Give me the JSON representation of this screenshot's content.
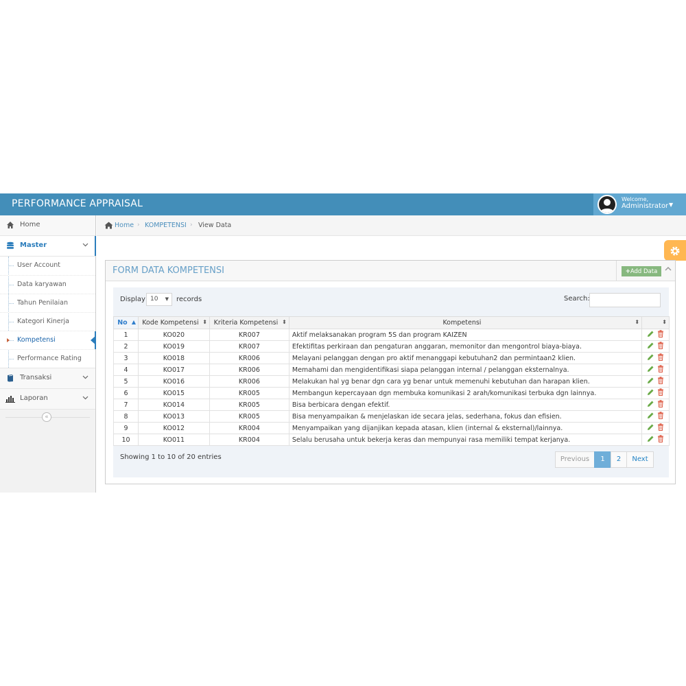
{
  "app": {
    "title": "PERFORMANCE APPRAISAL"
  },
  "user": {
    "greeting": "Welcome,",
    "name": "Administrator"
  },
  "sidebar": {
    "items": [
      {
        "label": "Home",
        "icon": "home-icon"
      },
      {
        "label": "Master",
        "icon": "database-icon"
      },
      {
        "label": "Transaksi",
        "icon": "book-icon"
      },
      {
        "label": "Laporan",
        "icon": "bar-chart-icon"
      }
    ],
    "master_sub": [
      {
        "label": "User Account"
      },
      {
        "label": "Data karyawan"
      },
      {
        "label": "Tahun Penilaian"
      },
      {
        "label": "Kategori Kinerja"
      },
      {
        "label": "Kompetensi"
      },
      {
        "label": "Performance Rating"
      }
    ]
  },
  "breadcrumb": {
    "home": "Home",
    "section": "KOMPETENSI",
    "current": "View Data"
  },
  "widget": {
    "title": "FORM DATA KOMPETENSI",
    "add_label": "Add Data"
  },
  "table_controls": {
    "display_label": "Display",
    "page_size": "10",
    "records_label": "records",
    "search_label": "Search:"
  },
  "table": {
    "headers": [
      "No",
      "Kode Kompetensi",
      "Kriteria Kompetensi",
      "Kompetensi",
      ""
    ],
    "rows": [
      [
        "1",
        "KO020",
        "KR007",
        "Aktif melaksanakan program 5S dan program KAIZEN"
      ],
      [
        "2",
        "KO019",
        "KR007",
        "Efektifitas perkiraan dan pengaturan anggaran, memonitor dan mengontrol biaya-biaya."
      ],
      [
        "3",
        "KO018",
        "KR006",
        "Melayani pelanggan dengan pro aktif menanggapi kebutuhan2 dan permintaan2 klien."
      ],
      [
        "4",
        "KO017",
        "KR006",
        "Memahami dan mengidentifikasi siapa pelanggan internal / pelanggan eksternalnya."
      ],
      [
        "5",
        "KO016",
        "KR006",
        "Melakukan hal yg benar dgn cara yg benar untuk memenuhi kebutuhan dan harapan klien."
      ],
      [
        "6",
        "KO015",
        "KR005",
        "Membangun kepercayaan dgn membuka komunikasi 2 arah/komunikasi terbuka dgn lainnya."
      ],
      [
        "7",
        "KO014",
        "KR005",
        "Bisa berbicara dengan efektif."
      ],
      [
        "8",
        "KO013",
        "KR005",
        "Bisa menyampaikan & menjelaskan ide secara jelas, sederhana, fokus dan efisien."
      ],
      [
        "9",
        "KO012",
        "KR004",
        "Menyampaikan yang dijanjikan kepada atasan, klien (internal & eksternal)/lainnya."
      ],
      [
        "10",
        "KO011",
        "KR004",
        "Selalu berusaha untuk bekerja keras dan mempunyai rasa memiliki tempat kerjanya."
      ]
    ]
  },
  "footer": {
    "info": "Showing 1 to 10 of 20 entries",
    "pagination": {
      "previous": "Previous",
      "pages": [
        "1",
        "2"
      ],
      "current": "1",
      "next": "Next"
    }
  },
  "colors": {
    "navbar": "#438eb9",
    "accent": "#2b7dbc",
    "settings": "#ffb752",
    "add_button": "#87b87f"
  }
}
